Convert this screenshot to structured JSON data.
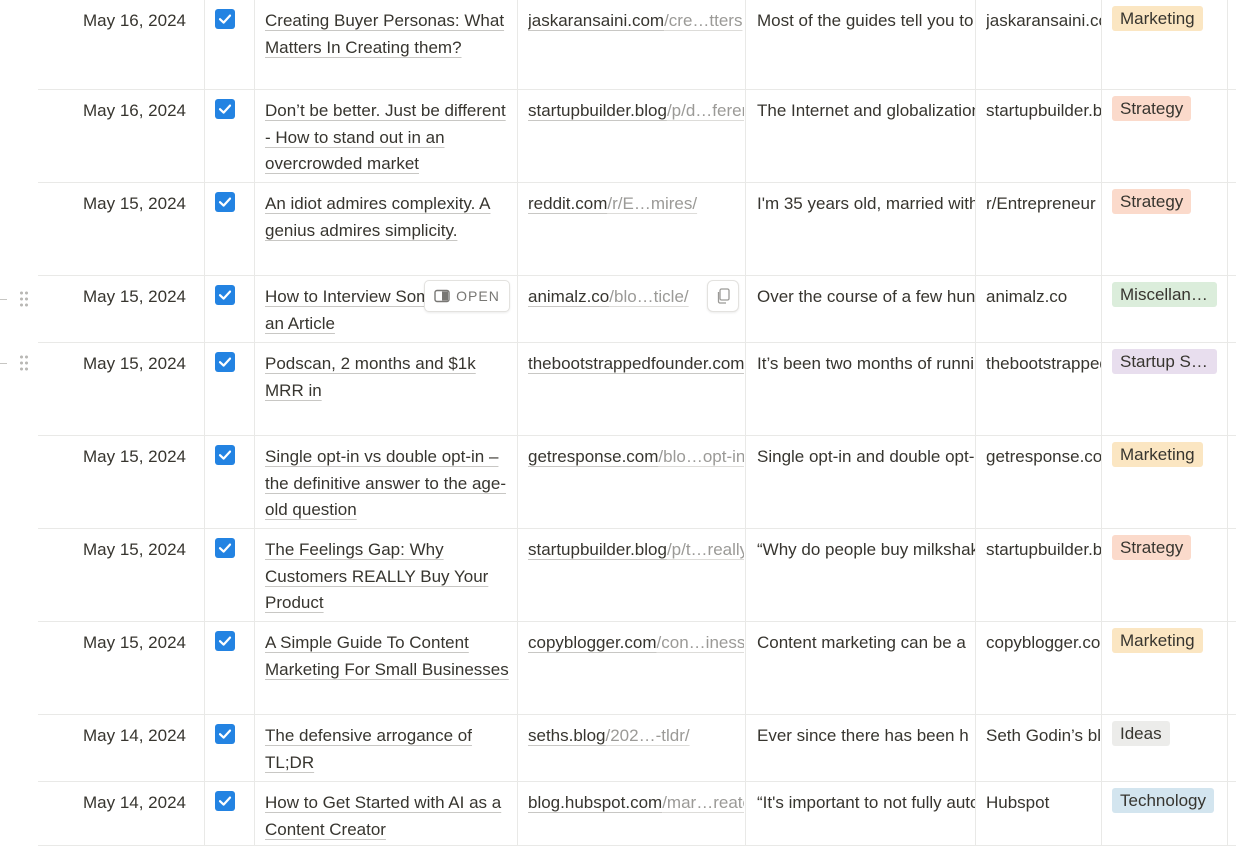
{
  "colors": {
    "checkbox": "#2383e2",
    "tag_orange_bg": "#fbe6c2",
    "tag_red_bg": "#fbdacb",
    "tag_green_bg": "#dbeddb",
    "tag_purple_bg": "#e8deee",
    "tag_gray_bg": "#ececea",
    "tag_blue_bg": "#d3e5ef"
  },
  "hover_controls": {
    "open_label": "OPEN",
    "open_icon": "side-peek-icon",
    "copy_icon": "copy-icon"
  },
  "rows": [
    {
      "date": "May 16, 2024",
      "done": true,
      "title": "Creating Buyer Personas: What Matters In Creating them?",
      "url_domain": "jaskaransaini.com",
      "url_path": "/cre…tters",
      "summary": "Most of the guides tell you to",
      "source": "jaskaransaini.com",
      "tag": "Marketing",
      "tag_color": "orange"
    },
    {
      "date": "May 16, 2024",
      "done": true,
      "title": "Don’t be better. Just be different - How to stand out in an overcrowded market",
      "url_domain": "startupbuilder.blog",
      "url_path": "/p/d…ferent",
      "summary": "The Internet and globalization",
      "source": "startupbuilder.blog",
      "tag": "Strategy",
      "tag_color": "red"
    },
    {
      "date": "May 15, 2024",
      "done": true,
      "title": "An idiot admires complexity. A genius admires simplicity.",
      "url_domain": "reddit.com",
      "url_path": "/r/E…mires/",
      "summary": "I'm 35 years old, married with",
      "source": "r/Entrepreneur",
      "tag": "Strategy",
      "tag_color": "red"
    },
    {
      "date": "May 15, 2024",
      "done": true,
      "title": "How to Interview Someone for an Article",
      "url_domain": "animalz.co",
      "url_path": "/blo…ticle/",
      "summary": "Over the course of a few hundred",
      "source": "animalz.co",
      "tag": "Miscellaneous",
      "tag_color": "green"
    },
    {
      "date": "May 15, 2024",
      "done": true,
      "title": "Podscan, 2 months and $1k MRR in",
      "url_domain": "thebootstrappedfounder.com",
      "url_path": "",
      "summary": "It’s been two months of running",
      "source": "thebootstrappedfounder.com",
      "tag": "Startup Stories",
      "tag_color": "purple"
    },
    {
      "date": "May 15, 2024",
      "done": true,
      "title": "Single opt-in vs double opt-in – the definitive answer to the age-old question",
      "url_domain": "getresponse.com",
      "url_path": "/blo…opt-in",
      "summary": "Single opt-in and double opt-in",
      "source": "getresponse.com",
      "tag": "Marketing",
      "tag_color": "orange"
    },
    {
      "date": "May 15, 2024",
      "done": true,
      "title": "The Feelings Gap: Why Customers REALLY Buy Your Product",
      "url_domain": "startupbuilder.blog",
      "url_path": "/p/t…really",
      "summary": "“Why do people buy milkshakes",
      "source": "startupbuilder.blog",
      "tag": "Strategy",
      "tag_color": "red"
    },
    {
      "date": "May 15, 2024",
      "done": true,
      "title": "A Simple Guide To Content Marketing For Small Businesses",
      "url_domain": "copyblogger.com",
      "url_path": "/con…inesses",
      "summary": "Content marketing can be a",
      "source": "copyblogger.com",
      "tag": "Marketing",
      "tag_color": "orange"
    },
    {
      "date": "May 14, 2024",
      "done": true,
      "title": "The defensive arrogance of TL;DR",
      "url_domain": "seths.blog",
      "url_path": "/202…-tldr/",
      "summary": "Ever since there has been h",
      "source": "Seth Godin’s blog",
      "tag": "Ideas",
      "tag_color": "gray"
    },
    {
      "date": "May 14, 2024",
      "done": true,
      "title": "How to Get Started with AI as a Content Creator",
      "url_domain": "blog.hubspot.com",
      "url_path": "/mar…reator",
      "summary": "“It's important to not fully automate",
      "source": "Hubspot",
      "tag": "Technology",
      "tag_color": "blue"
    }
  ]
}
